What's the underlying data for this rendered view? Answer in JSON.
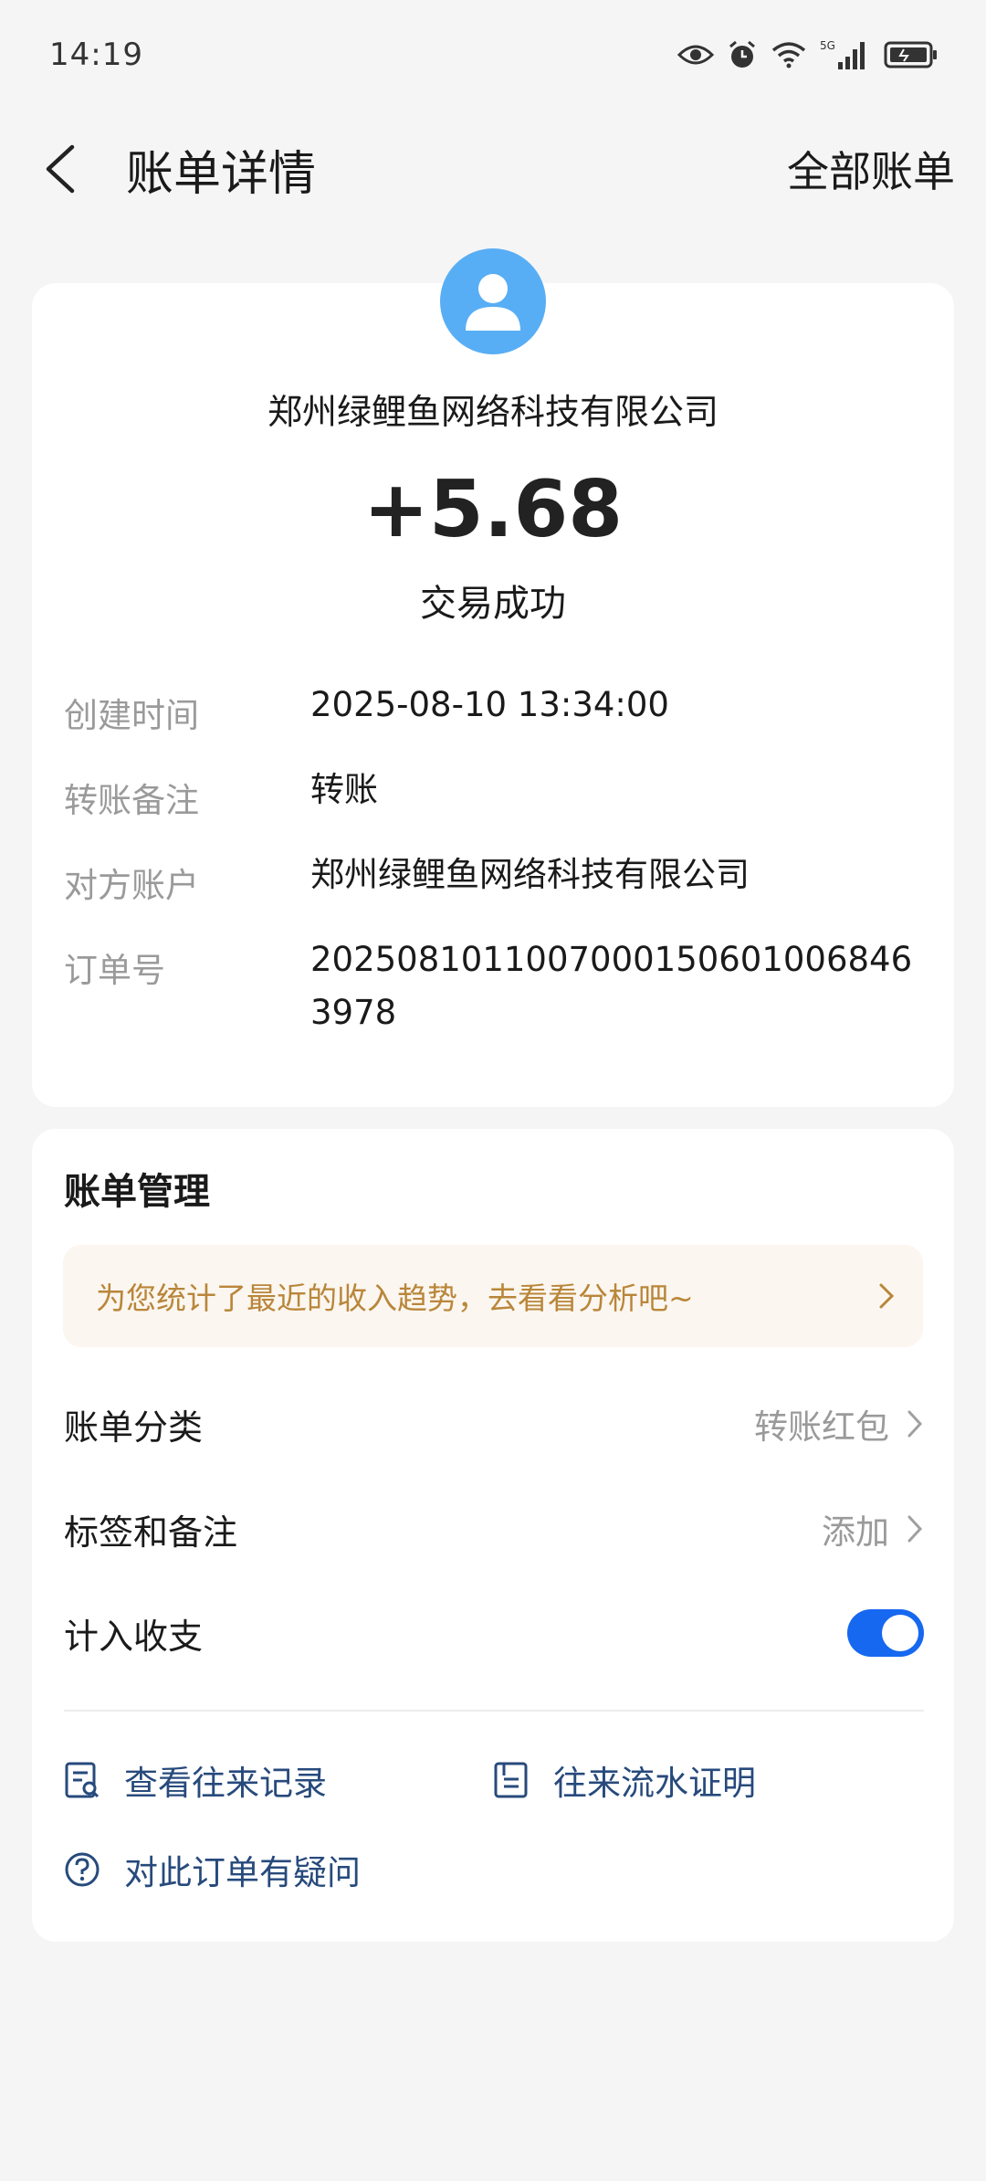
{
  "status_bar": {
    "time": "14:19",
    "network": "5G"
  },
  "nav": {
    "title": "账单详情",
    "right_action": "全部账单"
  },
  "transaction": {
    "payer_name": "郑州绿鲤鱼网络科技有限公司",
    "amount": "+5.68",
    "status": "交易成功",
    "details": [
      {
        "label": "创建时间",
        "value": "2025-08-10 13:34:00"
      },
      {
        "label": "转账备注",
        "value": "转账"
      },
      {
        "label": "对方账户",
        "value": "郑州绿鲤鱼网络科技有限公司"
      },
      {
        "label": "订单号",
        "value": "20250810110070001506010068463978"
      }
    ]
  },
  "management": {
    "title": "账单管理",
    "promo_text": "为您统计了最近的收入趋势，去看看分析吧~",
    "category_label": "账单分类",
    "category_value": "转账红包",
    "tags_label": "标签和备注",
    "tags_value": "添加",
    "include_label": "计入收支",
    "include_enabled": true,
    "actions": {
      "view_records": "查看往来记录",
      "flow_proof": "往来流水证明",
      "question": "对此订单有疑问"
    }
  },
  "colors": {
    "avatar_bg": "#58aef5",
    "toggle_on": "#1668f0",
    "promo_text": "#b9863a",
    "link_text": "#274a7c"
  }
}
